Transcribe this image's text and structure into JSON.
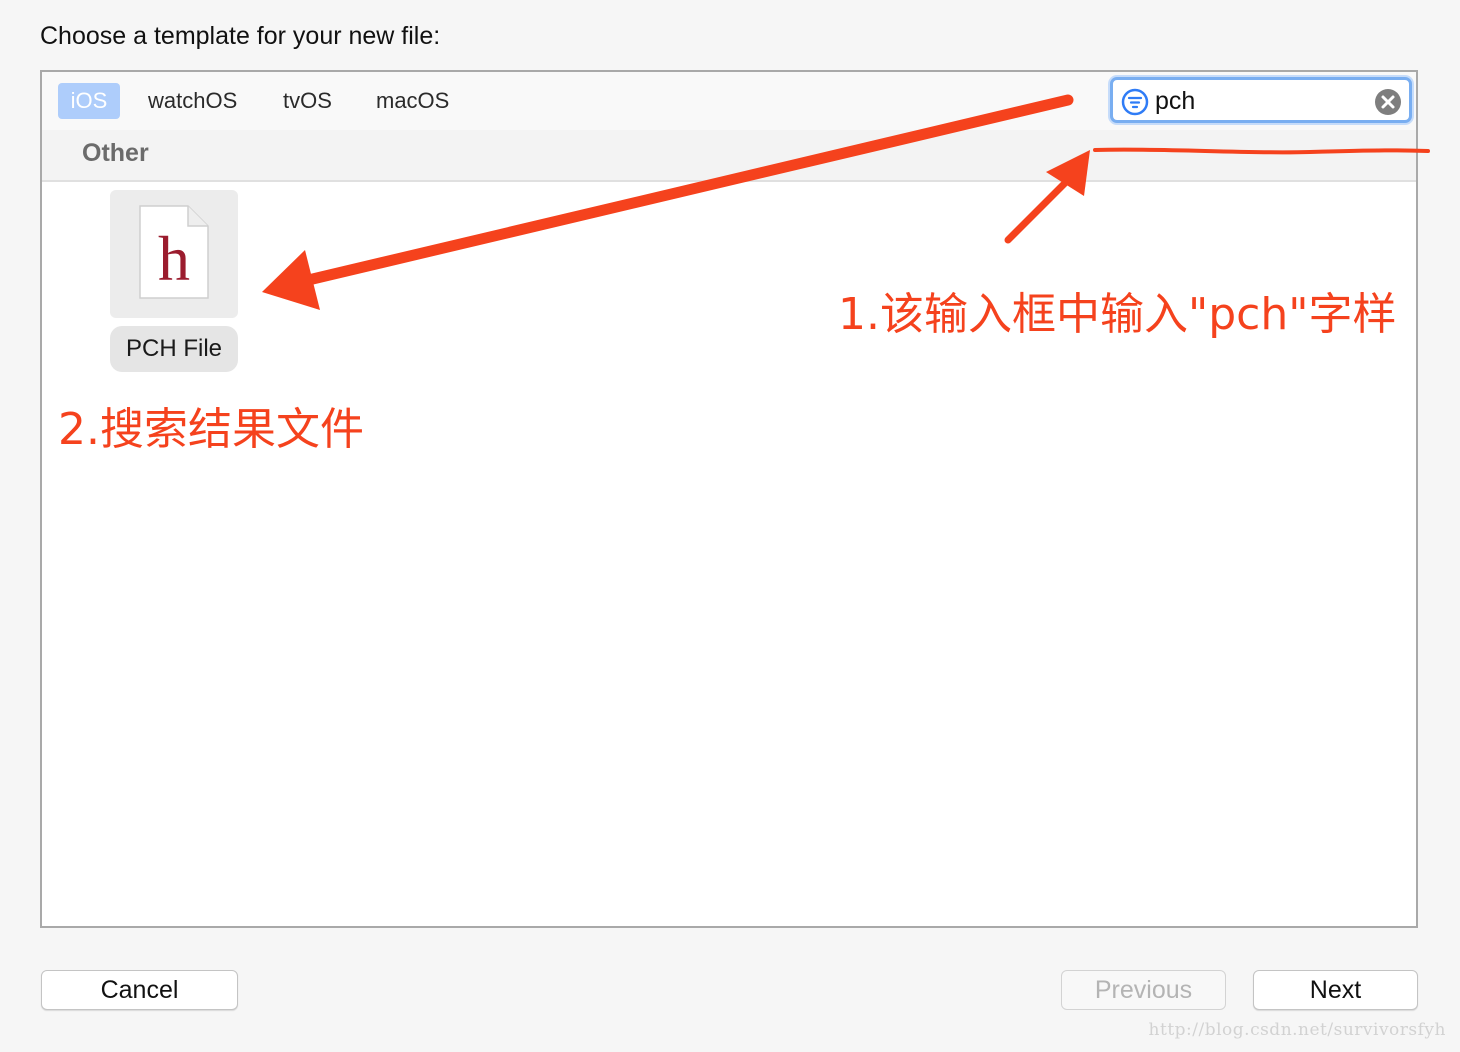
{
  "dialog": {
    "title": "Choose a template for your new file:"
  },
  "tabs": [
    {
      "label": "iOS",
      "selected": true
    },
    {
      "label": "watchOS",
      "selected": false
    },
    {
      "label": "tvOS",
      "selected": false
    },
    {
      "label": "macOS",
      "selected": false
    }
  ],
  "search": {
    "value": "pch",
    "filter_icon": "filter-icon",
    "clear_icon": "clear-icon"
  },
  "section": {
    "title": "Other"
  },
  "templates": [
    {
      "label": "PCH File",
      "icon": "header-file-icon",
      "icon_glyph": "h"
    }
  ],
  "buttons": {
    "cancel": "Cancel",
    "previous": "Previous",
    "next": "Next",
    "previous_enabled": false
  },
  "annotations": {
    "step1": "1.该输入框中输入\"pch\"字样",
    "step2": "2.搜索结果文件",
    "color": "#f5421d"
  },
  "watermark": "http://blog.csdn.net/survivorsfyh",
  "colors": {
    "selected_tab": "#aecdfb",
    "search_focus": "#79aef1",
    "glyph": "#9b1c2e"
  }
}
